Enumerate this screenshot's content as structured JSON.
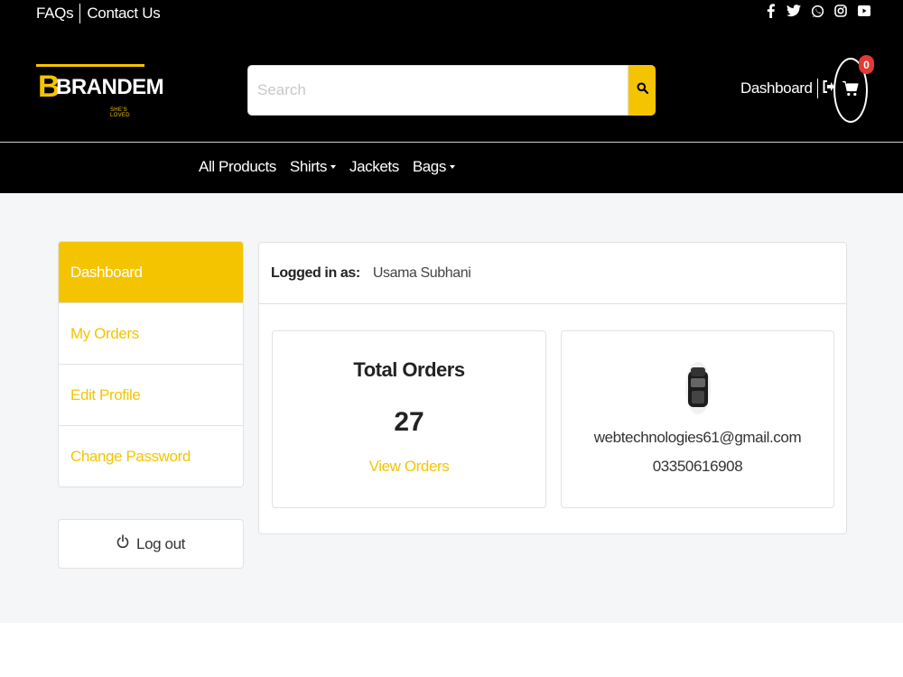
{
  "topbar": {
    "faqs_label": "FAQs",
    "contact_label": "Contact Us",
    "social_icons": [
      "facebook-icon",
      "twitter-icon",
      "whatsapp-icon",
      "instagram-icon",
      "youtube-icon"
    ]
  },
  "brand": {
    "initial": "B",
    "name": "BRANDEM",
    "tagline": "SHE'S LOVED",
    "accent_color": "#f5c400"
  },
  "search": {
    "placeholder": "Search",
    "value": ""
  },
  "account": {
    "dashboard_label": "Dashboard",
    "cart_count": "0"
  },
  "nav": {
    "items": [
      {
        "label": "All Products",
        "dropdown": false
      },
      {
        "label": "Shirts",
        "dropdown": true
      },
      {
        "label": "Jackets",
        "dropdown": false
      },
      {
        "label": "Bags",
        "dropdown": true
      }
    ]
  },
  "sidebar": {
    "items": [
      {
        "label": "Dashboard",
        "active": true
      },
      {
        "label": "My Orders",
        "active": false
      },
      {
        "label": "Edit Profile",
        "active": false
      },
      {
        "label": "Change Password",
        "active": false
      }
    ],
    "logout_label": "Log out"
  },
  "panel": {
    "logged_in_label": "Logged in as:",
    "user_name": "Usama Subhani",
    "orders": {
      "title": "Total Orders",
      "count": "27",
      "link": "View Orders"
    },
    "profile": {
      "email": "webtechnologies61@gmail.com",
      "phone": "03350616908"
    }
  }
}
